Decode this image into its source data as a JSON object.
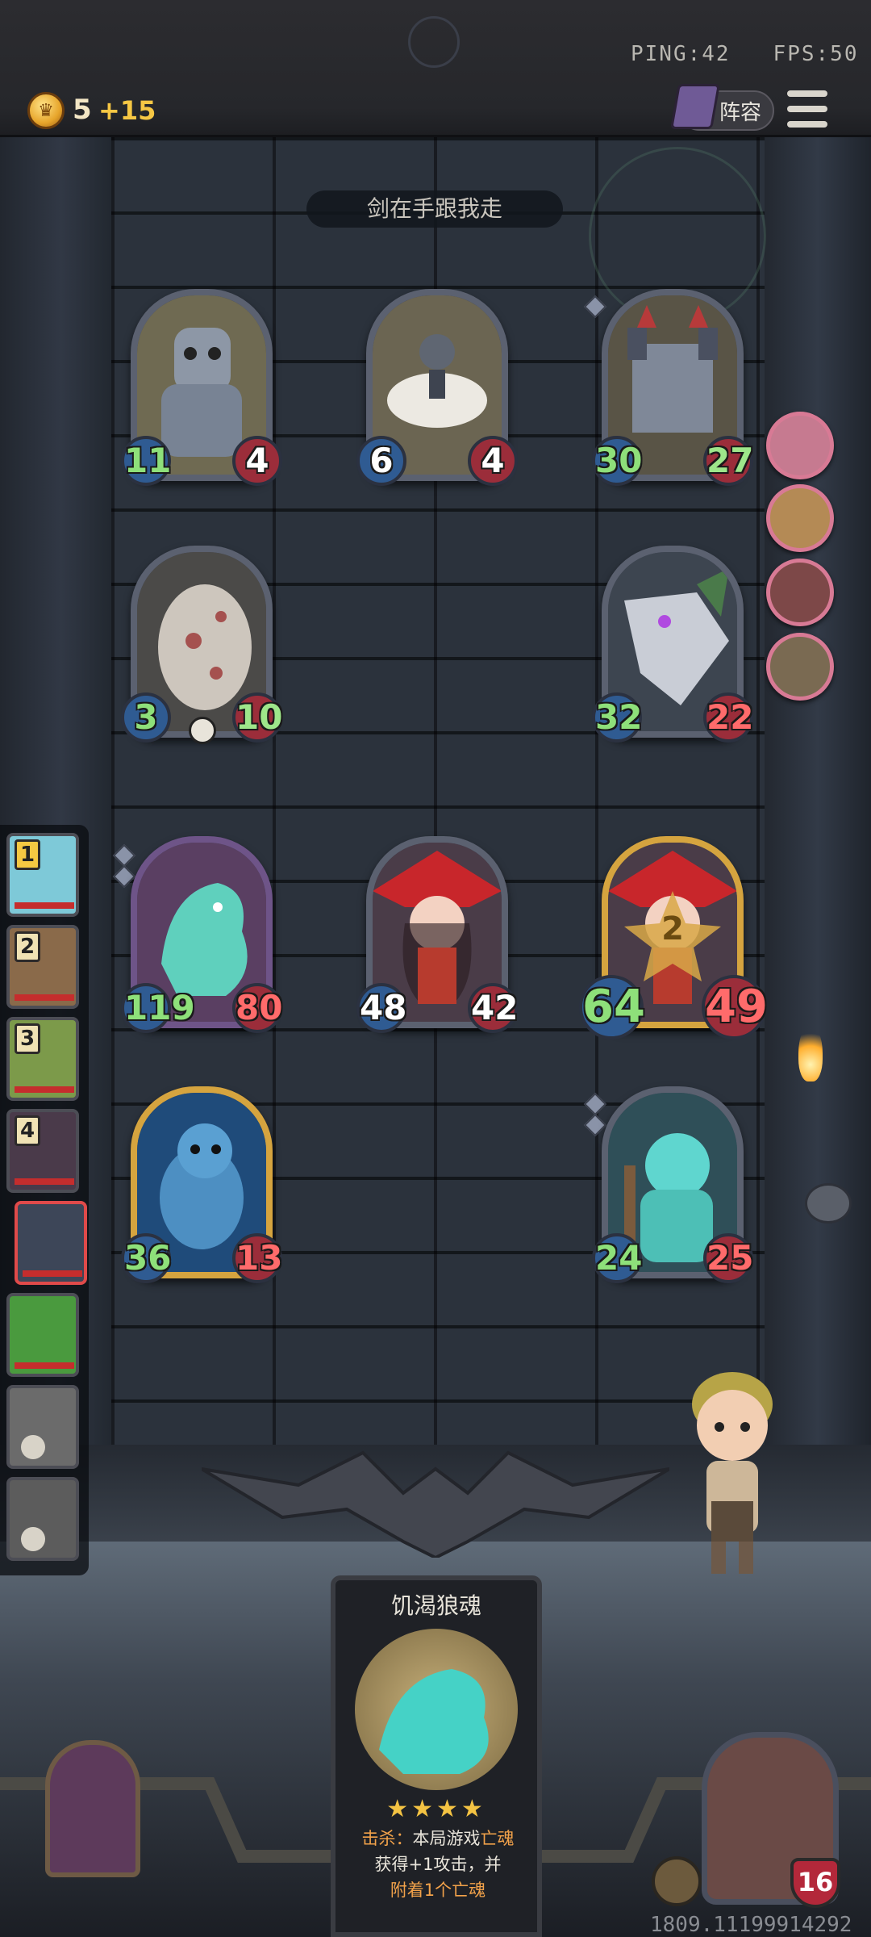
{
  "status_bar": {
    "ping": "PING:42",
    "fps": "FPS:50"
  },
  "top": {
    "gold": "5",
    "gold_income": "+15",
    "lineup_label": "阵容"
  },
  "enemy": {
    "name": "剑在手跟我走"
  },
  "enemy_board": [
    {
      "id": "robot",
      "attack": "11",
      "health": "4"
    },
    {
      "id": "ballerina-robot",
      "attack": "6",
      "health": "4"
    },
    {
      "id": "castle-golem",
      "attack": "30",
      "health": "27"
    },
    {
      "id": "egg",
      "attack": "3",
      "health": "10"
    },
    {
      "id": "bone-dragon",
      "attack": "32",
      "health": "22"
    }
  ],
  "player_board": [
    {
      "id": "ghost-wolf",
      "attack": "119",
      "health": "80"
    },
    {
      "id": "red-witch",
      "attack": "48",
      "health": "42"
    },
    {
      "id": "red-witch-golden",
      "attack": "64",
      "health": "49",
      "tier_badge": "2"
    },
    {
      "id": "blue-dragon",
      "attack": "36",
      "health": "13"
    },
    {
      "id": "spirit-warrior",
      "attack": "24",
      "health": "25"
    }
  ],
  "roster": [
    {
      "rank": "1",
      "hero": "elf-hero"
    },
    {
      "rank": "2",
      "hero": "clock-hero"
    },
    {
      "rank": "3",
      "hero": "goblin-hero"
    },
    {
      "rank": "4",
      "hero": "witch-hero"
    },
    {
      "rank": "",
      "hero": "raccoon-hero-self"
    },
    {
      "rank": "",
      "hero": "orc-hero"
    },
    {
      "rank": "",
      "hero": "old-man-hero-dead"
    },
    {
      "rank": "",
      "hero": "beast-hero-dead"
    }
  ],
  "shop_card": {
    "name": "饥渴狼魂",
    "stars": "★★★★",
    "desc_prefix": "击杀：",
    "desc_main": "本局游戏",
    "desc_hl": "亡魂",
    "desc_line2": "获得+1攻击，并",
    "desc_line3_hl": "附着1个亡魂"
  },
  "hero": {
    "health": "16"
  },
  "footer": {
    "build": "1809.11199914292"
  },
  "colors": {
    "attack_green": "#8ee07a",
    "health_red": "#ff6b6b",
    "gold": "#f6c744",
    "accent_frame": "#d5a43f"
  }
}
